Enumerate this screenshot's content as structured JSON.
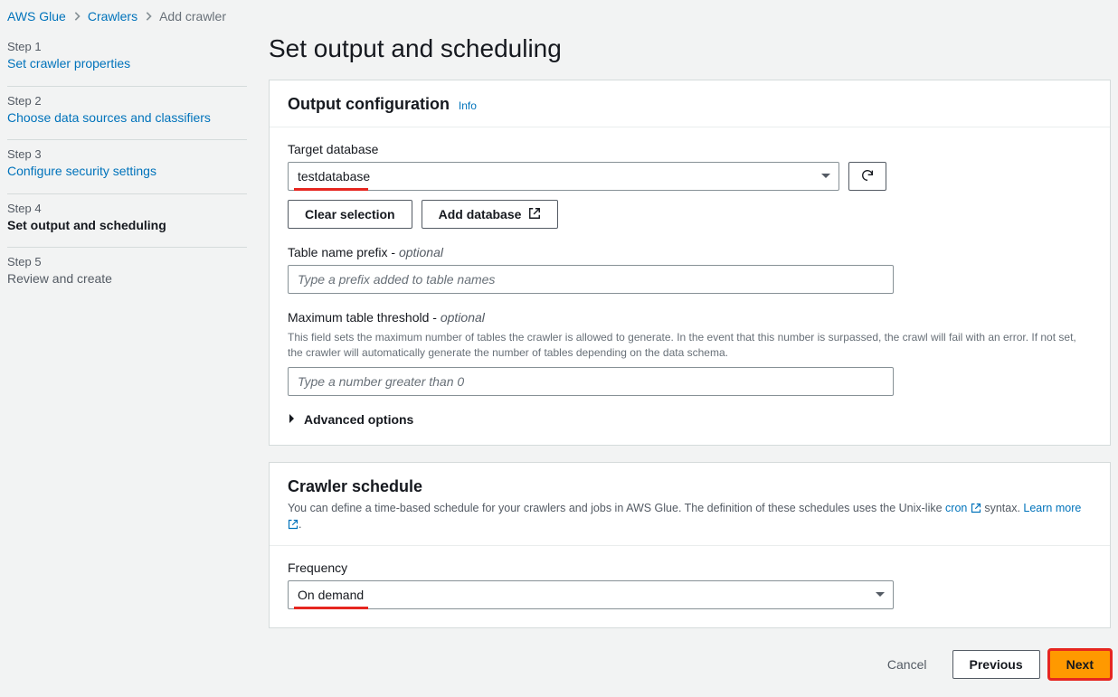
{
  "breadcrumb": {
    "items": [
      "AWS Glue",
      "Crawlers"
    ],
    "current": "Add crawler"
  },
  "steps": [
    {
      "num": "Step 1",
      "name": "Set crawler properties",
      "state": "done"
    },
    {
      "num": "Step 2",
      "name": "Choose data sources and classifiers",
      "state": "done"
    },
    {
      "num": "Step 3",
      "name": "Configure security settings",
      "state": "done"
    },
    {
      "num": "Step 4",
      "name": "Set output and scheduling",
      "state": "current"
    },
    {
      "num": "Step 5",
      "name": "Review and create",
      "state": "future"
    }
  ],
  "page_title": "Set output and scheduling",
  "output_panel": {
    "title": "Output configuration",
    "info": "Info",
    "target_db_label": "Target database",
    "target_db_value": "testdatabase",
    "clear_btn": "Clear selection",
    "add_db_btn": "Add database",
    "prefix_label": "Table name prefix -",
    "optional": "optional",
    "prefix_placeholder": "Type a prefix added to table names",
    "threshold_label": "Maximum table threshold -",
    "threshold_desc": "This field sets the maximum number of tables the crawler is allowed to generate. In the event that this number is surpassed, the crawl will fail with an error. If not set, the crawler will automatically generate the number of tables depending on the data schema.",
    "threshold_placeholder": "Type a number greater than 0",
    "advanced": "Advanced options"
  },
  "schedule_panel": {
    "title": "Crawler schedule",
    "desc_before": "You can define a time-based schedule for your crawlers and jobs in AWS Glue. The definition of these schedules uses the Unix-like ",
    "cron": "cron",
    "desc_mid": " syntax. ",
    "learn_more": "Learn more",
    "freq_label": "Frequency",
    "freq_value": "On demand"
  },
  "actions": {
    "cancel": "Cancel",
    "previous": "Previous",
    "next": "Next"
  }
}
